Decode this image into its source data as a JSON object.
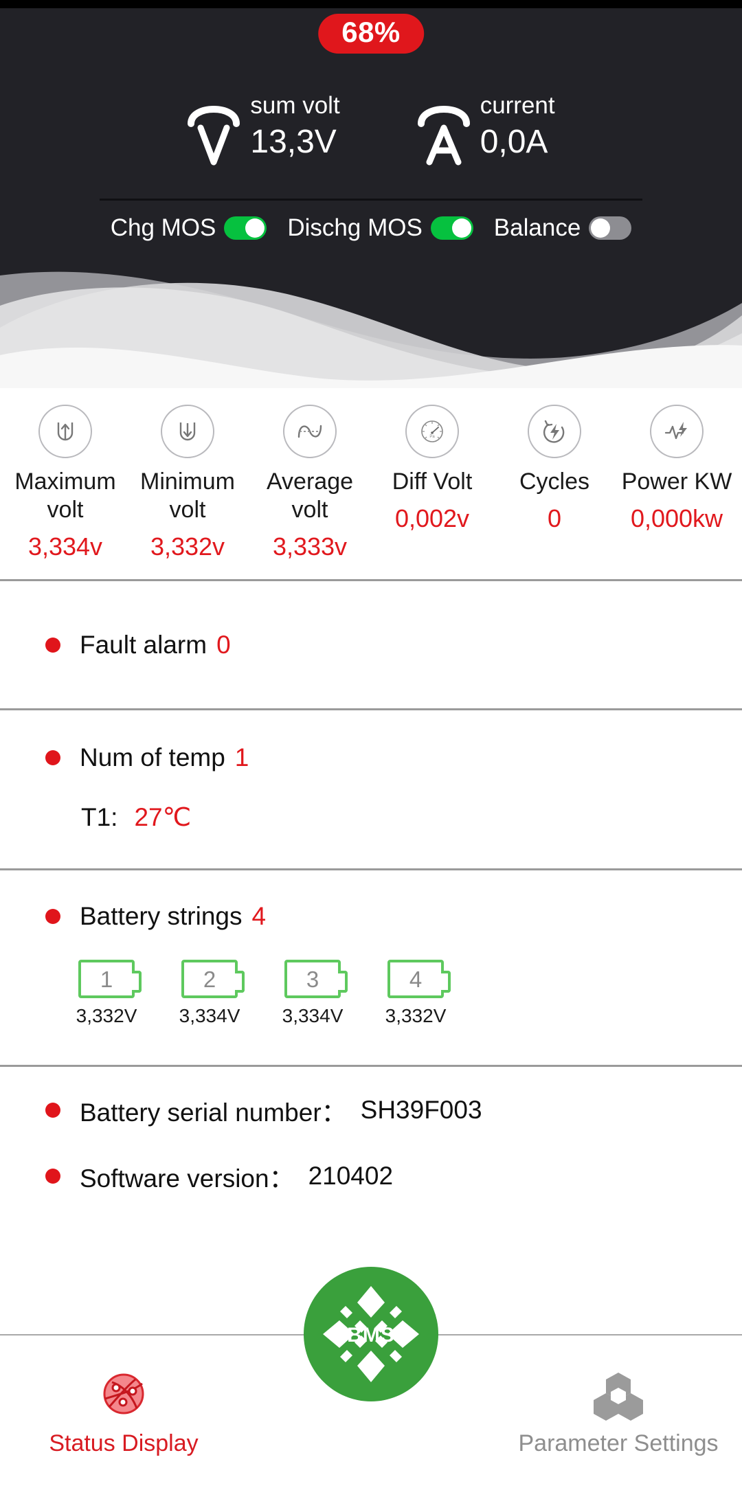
{
  "header": {
    "soc_badge": "68%",
    "meters": [
      {
        "icon": "voltmeter-icon",
        "label": "sum volt",
        "value": "13,3V"
      },
      {
        "icon": "ammeter-icon",
        "label": "current",
        "value": "0,0A"
      }
    ],
    "switches": [
      {
        "label": "Chg MOS",
        "state": "on"
      },
      {
        "label": "Dischg MOS",
        "state": "on"
      },
      {
        "label": "Balance",
        "state": "off"
      }
    ]
  },
  "stats": [
    {
      "icon": "max-volt-icon",
      "label": "Maximum volt",
      "value": "3,334v"
    },
    {
      "icon": "min-volt-icon",
      "label": "Minimum volt",
      "value": "3,332v"
    },
    {
      "icon": "avg-volt-icon",
      "label": "Average volt",
      "value": "3,333v"
    },
    {
      "icon": "gauge-icon",
      "label": "Diff Volt",
      "value": "0,002v"
    },
    {
      "icon": "cycles-icon",
      "label": "Cycles",
      "value": "0"
    },
    {
      "icon": "power-icon",
      "label": "Power KW",
      "value": "0,000kw"
    }
  ],
  "fault": {
    "label": "Fault alarm",
    "value": "0"
  },
  "temperature": {
    "label": "Num of temp",
    "count": "1",
    "sensors": [
      {
        "key": "T1:",
        "value": "27℃"
      }
    ]
  },
  "strings": {
    "label": "Battery strings",
    "count": "4",
    "cells": [
      {
        "index": "1",
        "voltage": "3,332V"
      },
      {
        "index": "2",
        "voltage": "3,334V"
      },
      {
        "index": "3",
        "voltage": "3,334V"
      },
      {
        "index": "4",
        "voltage": "3,332V"
      }
    ]
  },
  "meta": [
    {
      "label": "Battery serial number：",
      "value": "SH39F003"
    },
    {
      "label": "Software version：",
      "value": "210402"
    }
  ],
  "navbar": {
    "status_label": "Status Display",
    "settings_label": "Parameter Settings",
    "fab_text": "BMS"
  },
  "colors": {
    "accent_red": "#e0171c",
    "green": "#06c13f",
    "fab_green": "#3aa03c",
    "header_bg": "#222227",
    "cell_green": "#5ec95e",
    "inactive_gray": "#8e8e8e"
  }
}
